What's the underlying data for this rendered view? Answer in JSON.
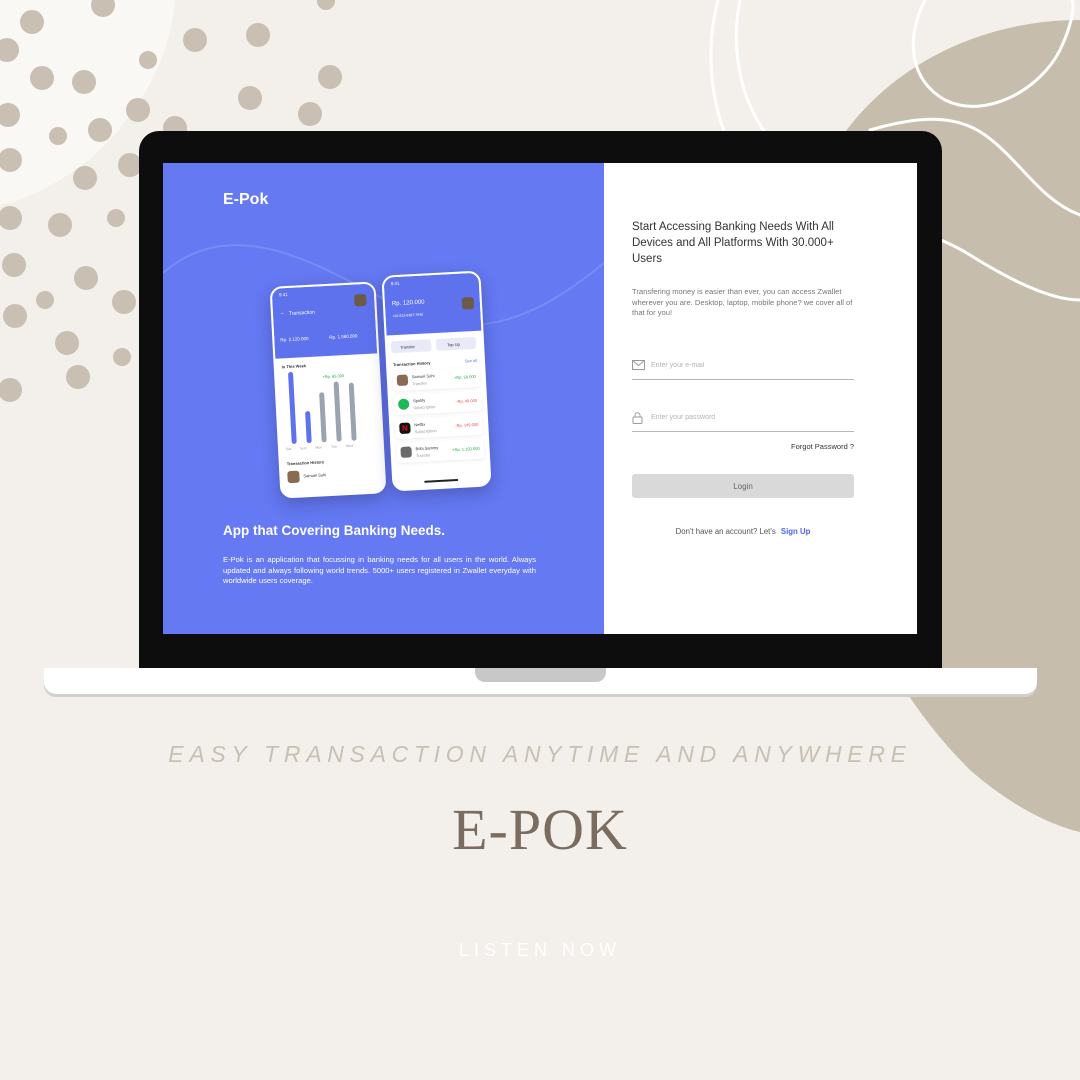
{
  "colors": {
    "background": "#f3efea",
    "accent_shape": "#c6bdad",
    "panel_blue": "#6479f2",
    "link_blue": "#4e63e8",
    "brand_brown": "#7a6d60"
  },
  "app": {
    "logo": "E-Pok",
    "tagline": "App that Covering Banking Needs.",
    "description": "E-Pok is an application that focussing in banking needs for all users in the world. Always updated and always following world trends. 5000+ users registered in Zwallet everyday with worldwide users coverage."
  },
  "mockup": {
    "phone_a": {
      "time": "9:41",
      "header": "Transaction",
      "income": "Rp. 2.120.000",
      "expense": "Rp. 1.560.000",
      "week_label": "In This Week",
      "chart_tag": "+Rp. 65.000",
      "days": [
        "Sat",
        "Sun",
        "Mon",
        "Tue",
        "Wed"
      ],
      "history_label": "Transaction History",
      "first_contact": "Samuel Suhi"
    },
    "phone_b": {
      "time": "9:41",
      "balance": "Rp. 120.000",
      "phone_number": "+62 813-9387-7946",
      "transfer_label": "Transfer",
      "topup_label": "Top Up",
      "history_label": "Transaction History",
      "see_all": "See all",
      "items": [
        {
          "name": "Samuel Suhi",
          "type": "Transfer",
          "amount": "+Rp. 50.000",
          "icon": "avatar-photo-icon"
        },
        {
          "name": "Spotify",
          "type": "Subscription",
          "amount": "-Rp. 49.000",
          "icon": "spotify-icon"
        },
        {
          "name": "Netflix",
          "type": "Subscription",
          "amount": "-Rp. 149.000",
          "icon": "netflix-icon"
        },
        {
          "name": "Bobi Sammy",
          "type": "Transfer",
          "amount": "+Rp. 1.150.000",
          "icon": "avatar-photo-icon"
        }
      ]
    }
  },
  "login": {
    "heading": "Start Accessing Banking Needs With All Devices and All Platforms With 30.000+ Users",
    "intro": "Transfering money is easier than ever, you can access Zwallet wherever you are. Desktop, laptop, mobile phone? we cover all of that for you!",
    "email_placeholder": "Enter your e-mail",
    "password_placeholder": "Enter your password",
    "forgot_password": "Forgot Password ?",
    "login_button": "Login",
    "signup_prompt": "Don't have an account? Let's",
    "signup_link": "Sign Up"
  },
  "poster": {
    "caption": "EASY TRANSACTION ANYTIME AND ANYWHERE",
    "brand": "E-POK",
    "cta": "LISTEN NOW"
  }
}
